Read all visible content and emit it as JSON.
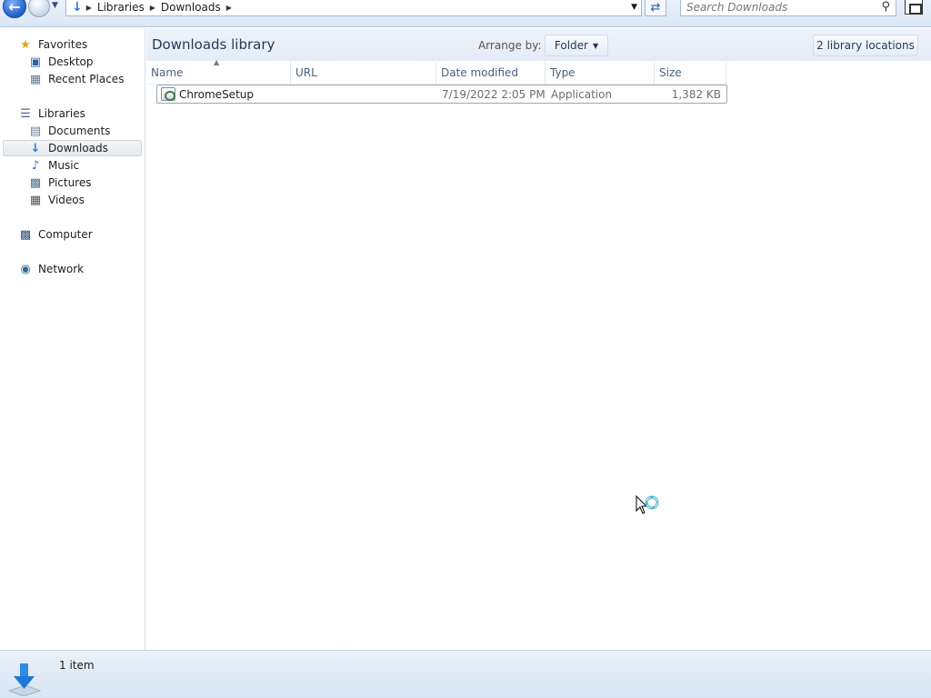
{
  "address_bar": {
    "crumbs": [
      "Libraries",
      "Downloads"
    ]
  },
  "search": {
    "placeholder": "Search Downloads"
  },
  "sidebar": {
    "favorites": {
      "label": "Favorites",
      "items": [
        {
          "label": "Desktop"
        },
        {
          "label": "Recent Places"
        }
      ]
    },
    "libraries": {
      "label": "Libraries",
      "items": [
        {
          "label": "Documents"
        },
        {
          "label": "Downloads"
        },
        {
          "label": "Music"
        },
        {
          "label": "Pictures"
        },
        {
          "label": "Videos"
        }
      ]
    },
    "computer": {
      "label": "Computer"
    },
    "network": {
      "label": "Network"
    }
  },
  "header": {
    "title": "Downloads library",
    "arrange_label": "Arrange by:",
    "arrange_value": "Folder",
    "locations": "2 library locations"
  },
  "columns": [
    "Name",
    "URL",
    "Date modified",
    "Type",
    "Size"
  ],
  "files": [
    {
      "name": "ChromeSetup",
      "url": "",
      "date": "7/19/2022 2:05 PM",
      "type": "Application",
      "size": "1,382 KB"
    }
  ],
  "status": {
    "count": "1 item"
  },
  "colors": {
    "accent": "#2a7be0",
    "header_bg": "#e4ecf7",
    "selection_border": "#9aa6b4"
  }
}
